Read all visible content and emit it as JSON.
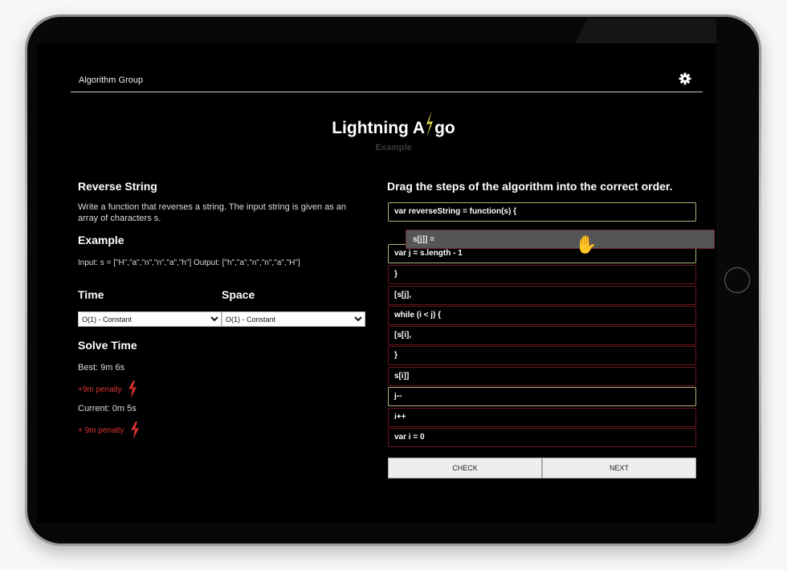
{
  "header": {
    "group": "Algorithm Group",
    "settings_icon": "gear-icon"
  },
  "app": {
    "title_prefix": "Lightning A",
    "title_suffix": "go",
    "subtitle": "Example",
    "bolt_color": "#e8e04a"
  },
  "problem": {
    "title": "Reverse String",
    "description": "Write a function that reverses a string. The input string is given as an array of characters s.",
    "example_heading": "Example",
    "example": "Input: s = [\"H\",\"a\",\"n\",\"n\",\"a\",\"h\"] Output: [\"h\",\"a\",\"n\",\"n\",\"a\",\"H\"]"
  },
  "complexity": {
    "time_label": "Time",
    "space_label": "Space",
    "time_value": "O(1) - Constant",
    "space_value": "O(1) - Constant"
  },
  "solve": {
    "heading": "Solve Time",
    "best": "Best: 9m 6s",
    "best_penalty": "+9m penalty",
    "current": "Current: 0m 5s",
    "current_penalty": "+ 9m penalty",
    "penalty_color": "#dd3333"
  },
  "steps": {
    "instruction": "Drag the steps of the algorithm into the correct order.",
    "dragging": "s[j]] =",
    "items": [
      {
        "text": "var reverseString = function(s) {",
        "state": "correct"
      },
      {
        "text": "var j = s.length - 1",
        "state": "correct"
      },
      {
        "text": "}",
        "state": "incorrect"
      },
      {
        "text": "[s[j],",
        "state": "incorrect"
      },
      {
        "text": "while (i < j) {",
        "state": "incorrect"
      },
      {
        "text": "[s[i],",
        "state": "incorrect"
      },
      {
        "text": "}",
        "state": "incorrect"
      },
      {
        "text": "s[i]]",
        "state": "incorrect"
      },
      {
        "text": "j--",
        "state": "correct"
      },
      {
        "text": "i++",
        "state": "incorrect"
      },
      {
        "text": "var i = 0",
        "state": "incorrect"
      }
    ],
    "check_label": "CHECK",
    "next_label": "NEXT"
  }
}
